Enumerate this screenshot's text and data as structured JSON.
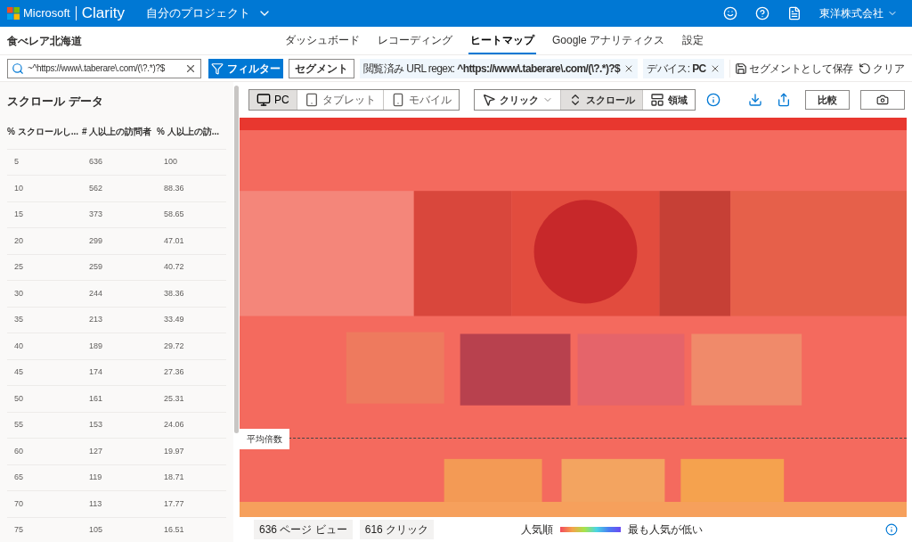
{
  "header": {
    "brand": "Microsoft",
    "product": "Clarity",
    "project": "自分のプロジェクト",
    "account": "東洋株式会社"
  },
  "site_name": "食べレア北海道",
  "tabs": [
    {
      "label": "ダッシュボード",
      "selected": false
    },
    {
      "label": "レコーディング",
      "selected": false
    },
    {
      "label": "ヒートマップ",
      "selected": true
    },
    {
      "label": "Google アナリティクス",
      "selected": false
    },
    {
      "label": "設定",
      "selected": false
    }
  ],
  "filter_bar": {
    "search_value": "~^https://www\\.taberare\\.com/(\\?.*)?$",
    "filter_button": "フィルター",
    "segment_button": "セグメント",
    "chips": [
      {
        "label": "閲覧済み URL regex: ",
        "value": "^https://www\\.taberare\\.com/(\\?.*)?$"
      },
      {
        "label": "デバイス: ",
        "value": "PC"
      }
    ],
    "save_segment": "セグメントとして保存",
    "clear": "クリア"
  },
  "scroll_panel": {
    "title": "スクロール データ",
    "columns": [
      "% スクロールし...",
      "# 人以上の訪問者",
      "% 人以上の訪..."
    ],
    "rows": [
      [
        "5",
        "636",
        "100"
      ],
      [
        "10",
        "562",
        "88.36"
      ],
      [
        "15",
        "373",
        "58.65"
      ],
      [
        "20",
        "299",
        "47.01"
      ],
      [
        "25",
        "259",
        "40.72"
      ],
      [
        "30",
        "244",
        "38.36"
      ],
      [
        "35",
        "213",
        "33.49"
      ],
      [
        "40",
        "189",
        "29.72"
      ],
      [
        "45",
        "174",
        "27.36"
      ],
      [
        "50",
        "161",
        "25.31"
      ],
      [
        "55",
        "153",
        "24.06"
      ],
      [
        "60",
        "127",
        "19.97"
      ],
      [
        "65",
        "119",
        "18.71"
      ],
      [
        "70",
        "113",
        "17.77"
      ],
      [
        "75",
        "105",
        "16.51"
      ]
    ]
  },
  "devices": [
    {
      "label": "PC",
      "kind": "desktop",
      "selected": true
    },
    {
      "label": "タブレット",
      "kind": "tablet",
      "selected": false
    },
    {
      "label": "モバイル",
      "kind": "mobile",
      "selected": false
    }
  ],
  "modes": [
    {
      "label": "クリック",
      "kind": "click",
      "selected": false
    },
    {
      "label": "スクロール",
      "kind": "scroll",
      "selected": true
    },
    {
      "label": "領域",
      "kind": "area",
      "selected": false
    }
  ],
  "compare_button": "比較",
  "fold_label": "平均倍数",
  "footer": {
    "page_views": "636 ページ ビュー",
    "clicks": "616 クリック",
    "legend_high": "人気順",
    "legend_low": "最も人気が低い"
  }
}
